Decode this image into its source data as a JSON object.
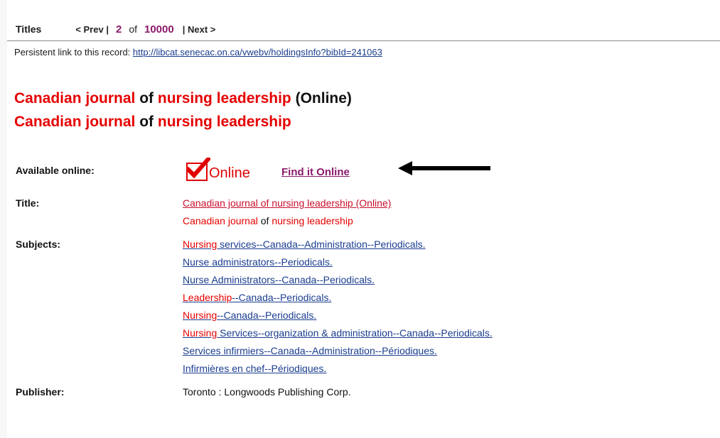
{
  "nav": {
    "titles_label": "Titles",
    "prev_label": "< Prev |",
    "current_page": "2",
    "of_label": "of",
    "total_pages": "10000",
    "next_label": "| Next >"
  },
  "permalink": {
    "label": "Persistent link to this record:",
    "url": "http://libcat.senecac.on.ca/vwebv/holdingsInfo?bibId=241063"
  },
  "heading": {
    "line1": {
      "part1": "Canadian journal",
      "part2": "of",
      "part3": "nursing leadership",
      "part4": "(Online)"
    },
    "line2": {
      "part1": "Canadian journal",
      "part2": "of",
      "part3": "nursing leadership"
    }
  },
  "available": {
    "label": "Available online:",
    "logo_text": "Online",
    "link_text": "Find it Online"
  },
  "title": {
    "label": "Title:",
    "link": "Canadian journal of nursing leadership (Online)",
    "alt": {
      "part1": "Canadian journal",
      "part2": "of",
      "part3": "nursing leadership"
    }
  },
  "subjects": {
    "label": "Subjects:",
    "items": [
      {
        "hl": "Nursing",
        "rest": " services--Canada--Administration--Periodicals."
      },
      {
        "hl": "",
        "rest": "Nurse administrators--Periodicals."
      },
      {
        "hl": "",
        "rest": "Nurse Administrators--Canada--Periodicals."
      },
      {
        "hl": "Leadership",
        "rest": "--Canada--Periodicals."
      },
      {
        "hl": "Nursing",
        "rest": "--Canada--Periodicals."
      },
      {
        "hl": "Nursing",
        "rest": " Services--organization & administration--Canada--Periodicals."
      },
      {
        "hl": "",
        "rest": "Services infirmiers--Canada--Administration--Périodiques."
      },
      {
        "hl": "",
        "rest": "Infirmières en chef--Périodiques."
      }
    ]
  },
  "publisher": {
    "label": "Publisher:",
    "value": "Toronto : Longwoods Publishing Corp."
  },
  "colors": {
    "highlight": "#e60000",
    "link": "#1a3d8f",
    "accent": "#8b1a6b"
  }
}
